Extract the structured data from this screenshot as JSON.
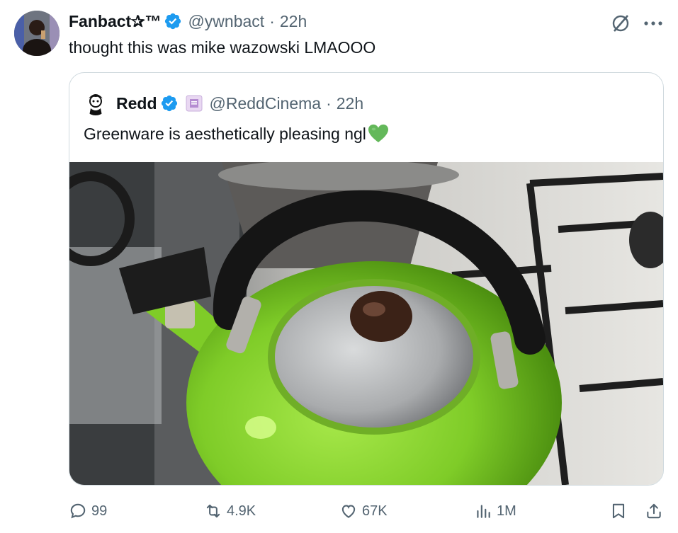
{
  "tweet": {
    "author_name": "Fanbact✰™",
    "handle": "@ywnbact",
    "separator": "·",
    "time": "22h",
    "text": "thought this was mike wazowski LMAOOO"
  },
  "quoted": {
    "author_name": "Redd",
    "handle": "@ReddCinema",
    "separator": "·",
    "time": "22h",
    "text": "Greenware is aesthetically pleasing ngl",
    "emoji": "green-heart"
  },
  "actions": {
    "replies": "99",
    "reposts": "4.9K",
    "likes": "67K",
    "views": "1M"
  },
  "icons": [
    "verified-badge-icon",
    "grok-icon",
    "more-icon",
    "reply-icon",
    "repost-icon",
    "like-icon",
    "views-icon",
    "bookmark-icon",
    "share-icon"
  ],
  "colors": {
    "text": "#0f1419",
    "secondary": "#536471",
    "verified": "#1d9bf0",
    "border": "#cfd9de",
    "kettle_green": "#7fcc28"
  }
}
